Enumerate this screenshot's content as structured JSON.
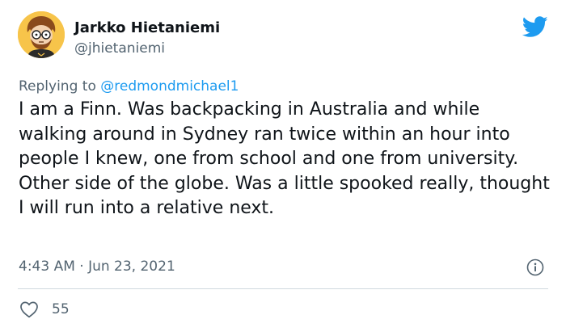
{
  "author": {
    "display_name": "Jarkko Hietaniemi",
    "handle": "@jhietaniemi",
    "avatar_icon": "cartoon-avatar-icon"
  },
  "reply": {
    "prefix": "Replying to ",
    "mention": "@redmondmichael1"
  },
  "tweet": {
    "text": "I am a Finn. Was backpacking in Australia and while walking around in Sydney ran twice within an hour into people I knew, one from school and one from university. Other side of the globe. Was a little spooked really, thought I will run into a relative next.",
    "timestamp": "4:43 AM · Jun 23, 2021"
  },
  "actions": {
    "like_count": "55",
    "like_icon": "heart-icon",
    "info_icon": "info-icon"
  },
  "brand": {
    "logo_icon": "twitter-bird-icon",
    "accent_color": "#1d9bf0",
    "muted_text_color": "#536471",
    "text_color": "#0f1419"
  }
}
